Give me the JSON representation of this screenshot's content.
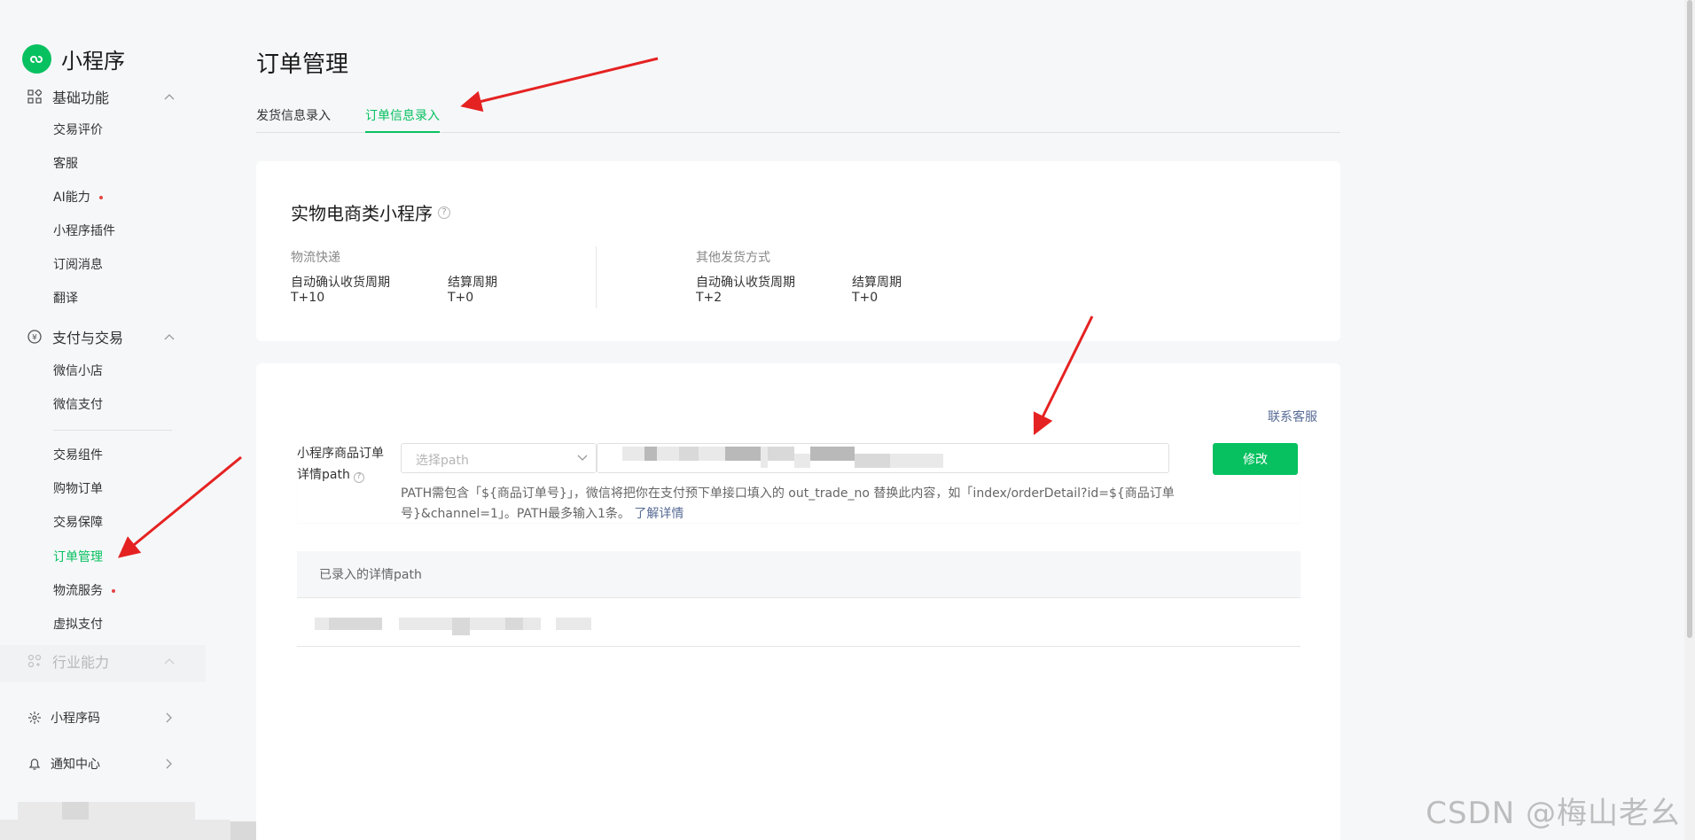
{
  "app": {
    "title": "小程序"
  },
  "sidebar": {
    "groups": [
      {
        "label": "基础功能",
        "items": [
          "交易评价",
          "客服",
          "AI能力",
          "小程序插件",
          "订阅消息",
          "翻译"
        ]
      },
      {
        "label": "支付与交易",
        "items": [
          "微信小店",
          "微信支付",
          "交易组件",
          "购物订单",
          "交易保障",
          "订单管理",
          "物流服务",
          "虚拟支付"
        ]
      },
      {
        "label": "行业能力"
      }
    ],
    "links": [
      {
        "label": "小程序码"
      },
      {
        "label": "通知中心"
      }
    ],
    "active_item": "订单管理"
  },
  "page": {
    "title": "订单管理",
    "tabs": [
      "发货信息录入",
      "订单信息录入"
    ],
    "active_tab": "订单信息录入"
  },
  "card1": {
    "title": "实物电商类小程序",
    "sections": [
      {
        "label": "物流快递",
        "fields": [
          {
            "key": "自动确认收货周期",
            "value": "T+10"
          },
          {
            "key": "结算周期",
            "value": "T+0"
          }
        ]
      },
      {
        "label": "其他发货方式",
        "fields": [
          {
            "key": "自动确认收货周期",
            "value": "T+2"
          },
          {
            "key": "结算周期",
            "value": "T+0"
          }
        ]
      }
    ]
  },
  "card2": {
    "contact_link": "联系客服",
    "form": {
      "label_line1": "小程序商品订单",
      "label_line2": "详情path",
      "select_placeholder": "选择path",
      "save_button": "修改",
      "hint_text": "PATH需包含「${商品订单号}」，微信将把你在支付预下单接口填入的 out_trade_no 替换此内容，如「index/orderDetail?id=${商品订单号}&channel=1」。PATH最多输入1条。",
      "hint_link": "了解详情"
    },
    "table": {
      "header": "已录入的详情path"
    }
  },
  "watermark": "CSDN @梅山老幺",
  "colors": {
    "accent": "#07c160",
    "link": "#576b95",
    "annotation_arrow": "#e52222"
  }
}
